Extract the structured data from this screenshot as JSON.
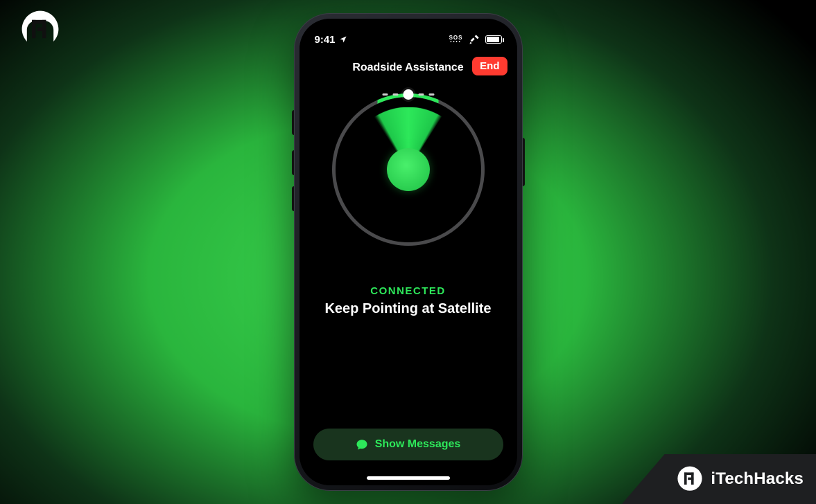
{
  "statusbar": {
    "time": "9:41",
    "sos_label": "SOS"
  },
  "nav": {
    "title": "Roadside Assistance",
    "end_label": "End"
  },
  "status": {
    "connected_label": "CONNECTED",
    "instruction": "Keep Pointing at Satellite"
  },
  "footer_button": {
    "label": "Show Messages"
  },
  "branding": {
    "name": "iTechHacks"
  },
  "colors": {
    "accent_green": "#2de85a",
    "danger_red": "#ff3b30"
  }
}
